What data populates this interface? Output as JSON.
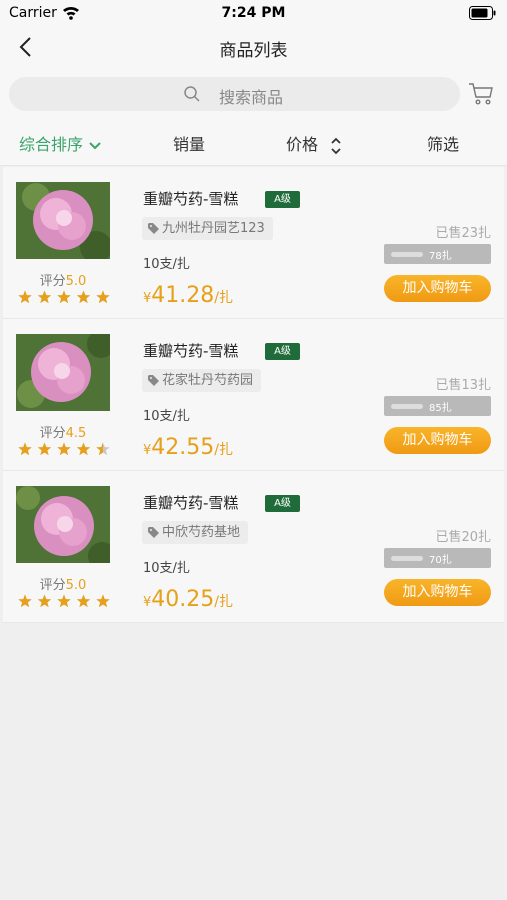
{
  "status_bar": {
    "carrier": "Carrier",
    "time": "7:24 PM"
  },
  "nav": {
    "title": "商品列表"
  },
  "search": {
    "placeholder": "搜索商品"
  },
  "filters": {
    "comprehensive": "综合排序",
    "sales": "销量",
    "price": "价格",
    "filter": "筛选"
  },
  "colors": {
    "accent_green": "#3aa46a",
    "price_orange": "#e6a01a",
    "grade_green": "#1f6b3a"
  },
  "products": [
    {
      "rating_label": "评分",
      "rating": "5.0",
      "stars": 5,
      "name": "重瓣芍药-雪糕",
      "grade": "A级",
      "shop": "九州牡丹园艺123",
      "spec": "10支/扎",
      "currency": "¥",
      "price": "41.28",
      "unit": "/扎",
      "sold": "已售23扎",
      "stock": "78扎",
      "add_label": "加入购物车"
    },
    {
      "rating_label": "评分",
      "rating": "4.5",
      "stars": 4.5,
      "name": "重瓣芍药-雪糕",
      "grade": "A级",
      "shop": "花家牡丹芍药园",
      "spec": "10支/扎",
      "currency": "¥",
      "price": "42.55",
      "unit": "/扎",
      "sold": "已售13扎",
      "stock": "85扎",
      "add_label": "加入购物车"
    },
    {
      "rating_label": "评分",
      "rating": "5.0",
      "stars": 5,
      "name": "重瓣芍药-雪糕",
      "grade": "A级",
      "shop": "中欣芍药基地",
      "spec": "10支/扎",
      "currency": "¥",
      "price": "40.25",
      "unit": "/扎",
      "sold": "已售20扎",
      "stock": "70扎",
      "add_label": "加入购物车"
    }
  ]
}
